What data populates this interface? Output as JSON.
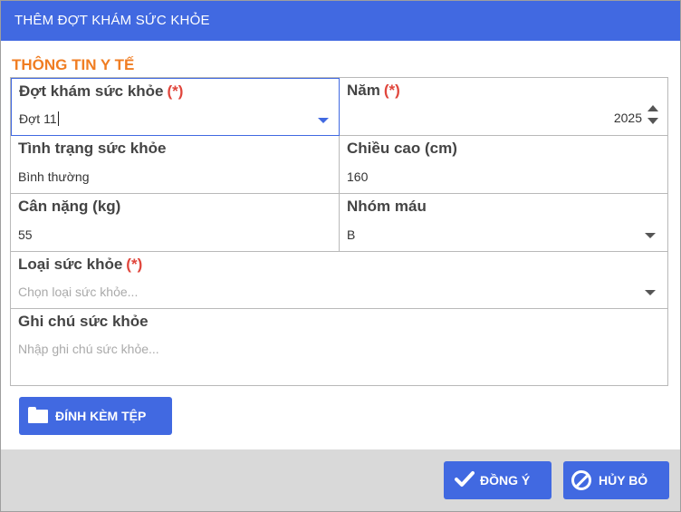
{
  "dialog": {
    "title": "THÊM ĐỢT KHÁM SỨC KHỎE",
    "section_title": "THÔNG TIN Y TẾ",
    "required_marker": "(*)",
    "fields": {
      "dot_kham": {
        "label": "Đợt khám sức khỏe",
        "value": "Đợt 11"
      },
      "nam": {
        "label": "Năm",
        "value": "2025"
      },
      "tinh_trang": {
        "label": "Tình trạng sức khỏe",
        "value": "Bình thường"
      },
      "chieu_cao": {
        "label": "Chiều cao (cm)",
        "value": "160"
      },
      "can_nang": {
        "label": "Cân nặng (kg)",
        "value": "55"
      },
      "nhom_mau": {
        "label": "Nhóm máu",
        "value": "B"
      },
      "loai_suc_khoe": {
        "label": "Loại sức khỏe",
        "placeholder": "Chọn loại sức khỏe..."
      },
      "ghi_chu": {
        "label": "Ghi chú sức khỏe",
        "placeholder": "Nhập ghi chú sức khỏe..."
      }
    },
    "attach_button": "ĐÍNH KÈM TỆP",
    "ok_button": "ĐỒNG Ý",
    "cancel_button": "HỦY BỎ",
    "colors": {
      "primary": "#4169e1",
      "section_title": "#f07d22",
      "required": "#e0463c",
      "footer_bg": "#d9d9d9"
    },
    "icons": {
      "dropdown": "chevron-down-icon",
      "spinner": "spinner-arrows-icon",
      "attach": "folder-icon",
      "ok": "check-icon",
      "cancel": "ban-icon"
    }
  }
}
